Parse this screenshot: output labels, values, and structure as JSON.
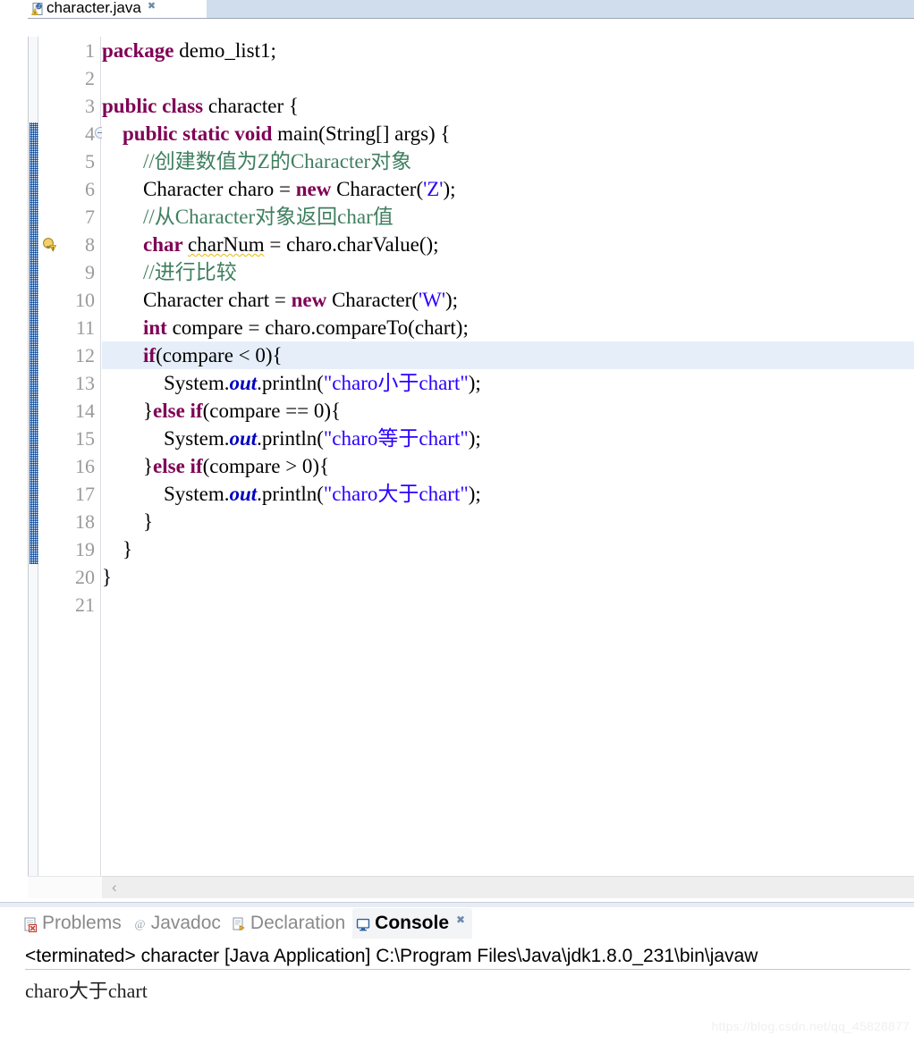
{
  "editor": {
    "tab": {
      "label": "character.java",
      "icon": "java-file-warning-icon",
      "close": "✖"
    },
    "active_line": 12,
    "warning_line": 8,
    "fold_line": 4,
    "colors": {
      "keyword": "#7f0055",
      "string": "#2a00ff",
      "comment": "#3f7f5f",
      "field": "#0000c0",
      "highlight_row": "#e6eff9",
      "tabstrip": "#cfdded",
      "range_marker": "#2a6ebb",
      "warning_squiggle": "#e8b80b"
    },
    "lines": [
      {
        "n": "1",
        "tokens": [
          {
            "t": "package ",
            "c": "kw"
          },
          {
            "t": "demo_list1;",
            "c": "plain"
          }
        ]
      },
      {
        "n": "2",
        "tokens": []
      },
      {
        "n": "3",
        "tokens": [
          {
            "t": "public class ",
            "c": "kw"
          },
          {
            "t": "character {",
            "c": "plain"
          }
        ]
      },
      {
        "n": "4",
        "tokens": [
          {
            "t": "    ",
            "c": "plain"
          },
          {
            "t": "public static void ",
            "c": "kw"
          },
          {
            "t": "main(String[] args) {",
            "c": "plain"
          }
        ]
      },
      {
        "n": "5",
        "tokens": [
          {
            "t": "        ",
            "c": "plain"
          },
          {
            "t": "//创建数值为Z的Character对象",
            "c": "cmt"
          }
        ]
      },
      {
        "n": "6",
        "tokens": [
          {
            "t": "        Character charo = ",
            "c": "plain"
          },
          {
            "t": "new ",
            "c": "kw"
          },
          {
            "t": "Character(",
            "c": "plain"
          },
          {
            "t": "'Z'",
            "c": "str"
          },
          {
            "t": ");",
            "c": "plain"
          }
        ]
      },
      {
        "n": "7",
        "tokens": [
          {
            "t": "        ",
            "c": "plain"
          },
          {
            "t": "//从Character对象返回char值",
            "c": "cmt"
          }
        ]
      },
      {
        "n": "8",
        "tokens": [
          {
            "t": "        ",
            "c": "plain"
          },
          {
            "t": "char ",
            "c": "kw"
          },
          {
            "t": "charNum",
            "c": "warn"
          },
          {
            "t": " = charo.charValue();",
            "c": "plain"
          }
        ]
      },
      {
        "n": "9",
        "tokens": [
          {
            "t": "        ",
            "c": "plain"
          },
          {
            "t": "//进行比较",
            "c": "cmt"
          }
        ]
      },
      {
        "n": "10",
        "tokens": [
          {
            "t": "        Character chart = ",
            "c": "plain"
          },
          {
            "t": "new ",
            "c": "kw"
          },
          {
            "t": "Character(",
            "c": "plain"
          },
          {
            "t": "'W'",
            "c": "str"
          },
          {
            "t": ");",
            "c": "plain"
          }
        ]
      },
      {
        "n": "11",
        "tokens": [
          {
            "t": "        ",
            "c": "plain"
          },
          {
            "t": "int ",
            "c": "kw"
          },
          {
            "t": "compare = charo.compareTo(chart);",
            "c": "plain"
          }
        ]
      },
      {
        "n": "12",
        "tokens": [
          {
            "t": "        ",
            "c": "plain"
          },
          {
            "t": "if",
            "c": "kw"
          },
          {
            "t": "(compare < 0){",
            "c": "plain"
          }
        ]
      },
      {
        "n": "13",
        "tokens": [
          {
            "t": "            System.",
            "c": "plain"
          },
          {
            "t": "out",
            "c": "fld"
          },
          {
            "t": ".println(",
            "c": "plain"
          },
          {
            "t": "\"charo小于chart\"",
            "c": "str"
          },
          {
            "t": ");",
            "c": "plain"
          }
        ]
      },
      {
        "n": "14",
        "tokens": [
          {
            "t": "        }",
            "c": "plain"
          },
          {
            "t": "else if",
            "c": "kw"
          },
          {
            "t": "(compare == 0){",
            "c": "plain"
          }
        ]
      },
      {
        "n": "15",
        "tokens": [
          {
            "t": "            System.",
            "c": "plain"
          },
          {
            "t": "out",
            "c": "fld"
          },
          {
            "t": ".println(",
            "c": "plain"
          },
          {
            "t": "\"charo等于chart\"",
            "c": "str"
          },
          {
            "t": ");",
            "c": "plain"
          }
        ]
      },
      {
        "n": "16",
        "tokens": [
          {
            "t": "        }",
            "c": "plain"
          },
          {
            "t": "else if",
            "c": "kw"
          },
          {
            "t": "(compare > 0){",
            "c": "plain"
          }
        ]
      },
      {
        "n": "17",
        "tokens": [
          {
            "t": "            System.",
            "c": "plain"
          },
          {
            "t": "out",
            "c": "fld"
          },
          {
            "t": ".println(",
            "c": "plain"
          },
          {
            "t": "\"charo大于chart\"",
            "c": "str"
          },
          {
            "t": ");",
            "c": "plain"
          }
        ]
      },
      {
        "n": "18",
        "tokens": [
          {
            "t": "        }",
            "c": "plain"
          }
        ]
      },
      {
        "n": "19",
        "tokens": [
          {
            "t": "    }",
            "c": "plain"
          }
        ]
      },
      {
        "n": "20",
        "tokens": [
          {
            "t": "}",
            "c": "plain"
          }
        ]
      },
      {
        "n": "21",
        "tokens": []
      }
    ],
    "scrollbar": {
      "left_arrow": "‹"
    }
  },
  "bottom_panel": {
    "tabs": [
      {
        "label": "Problems",
        "icon": "problems-icon",
        "active": false
      },
      {
        "label": "Javadoc",
        "icon": "javadoc-at-icon",
        "active": false
      },
      {
        "label": "Declaration",
        "icon": "declaration-icon",
        "active": false
      },
      {
        "label": "Console",
        "icon": "console-icon",
        "active": true,
        "close": "✖"
      }
    ],
    "console": {
      "header": "<terminated> character [Java Application] C:\\Program Files\\Java\\jdk1.8.0_231\\bin\\javaw",
      "output": "charo大于chart"
    }
  },
  "watermark": {
    "text": "https://blog.csdn.net/qq_45828877"
  }
}
